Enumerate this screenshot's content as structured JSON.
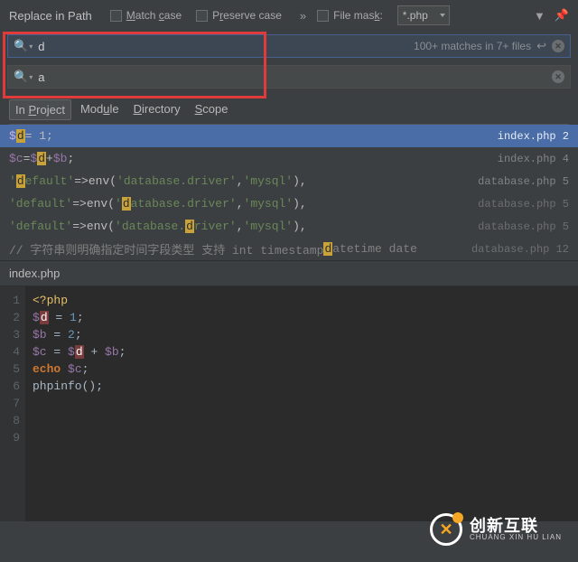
{
  "header": {
    "title": "Replace in Path",
    "match_case": "Match case",
    "preserve_case": "Preserve case",
    "file_mask_label": "File mask:",
    "file_mask_value": "*.php"
  },
  "search": {
    "find_value": "d",
    "replace_value": "a",
    "match_info": "100+ matches in 7+ files"
  },
  "scope_tabs": {
    "project": "In Project",
    "module": "Module",
    "directory": "Directory",
    "scope": "Scope"
  },
  "results": [
    {
      "tokens": [
        {
          "t": "$",
          "c": "m-var"
        },
        {
          "t": "d",
          "c": "hl-box"
        },
        {
          "t": " = 1;",
          "c": "m-op"
        }
      ],
      "file": "index.php",
      "line": "2",
      "sel": true
    },
    {
      "tokens": [
        {
          "t": "$c",
          "c": "m-var"
        },
        {
          "t": " = ",
          "c": "m-op"
        },
        {
          "t": "$",
          "c": "m-var"
        },
        {
          "t": "d",
          "c": "hl-box"
        },
        {
          "t": " + ",
          "c": "m-op"
        },
        {
          "t": "$b",
          "c": "m-var"
        },
        {
          "t": ";",
          "c": "m-op"
        }
      ],
      "file": "index.php",
      "line": "4"
    },
    {
      "tokens": [
        {
          "t": "'",
          "c": "m-str"
        },
        {
          "t": "d",
          "c": "hl-box"
        },
        {
          "t": "efault'",
          "c": "m-str"
        },
        {
          "t": "      => ",
          "c": "m-op"
        },
        {
          "t": "env(",
          "c": ""
        },
        {
          "t": "'database.driver'",
          "c": "m-str"
        },
        {
          "t": ", ",
          "c": "m-op"
        },
        {
          "t": "'mysql'",
          "c": "m-str"
        },
        {
          "t": "),",
          "c": "m-op"
        }
      ],
      "file": "database.php",
      "line": "5"
    },
    {
      "tokens": [
        {
          "t": "'default'",
          "c": "m-str"
        },
        {
          "t": "      => ",
          "c": "m-op"
        },
        {
          "t": "env(",
          "c": ""
        },
        {
          "t": "'",
          "c": "m-str"
        },
        {
          "t": "d",
          "c": "hl-box"
        },
        {
          "t": "atabase.driver'",
          "c": "m-str"
        },
        {
          "t": ", ",
          "c": "m-op"
        },
        {
          "t": "'mysql'",
          "c": "m-str"
        },
        {
          "t": "),",
          "c": "m-op"
        }
      ],
      "file": "database.php",
      "line": "5",
      "dim": true
    },
    {
      "tokens": [
        {
          "t": "'default'",
          "c": "m-str"
        },
        {
          "t": "      => ",
          "c": "m-op"
        },
        {
          "t": "env(",
          "c": ""
        },
        {
          "t": "'database.",
          "c": "m-str"
        },
        {
          "t": "d",
          "c": "hl-box"
        },
        {
          "t": "river'",
          "c": "m-str"
        },
        {
          "t": ", ",
          "c": "m-op"
        },
        {
          "t": "'mysql'",
          "c": "m-str"
        },
        {
          "t": "),",
          "c": "m-op"
        }
      ],
      "file": "database.php",
      "line": "5",
      "dim": true
    },
    {
      "tokens": [
        {
          "t": "// 字符串则明确指定时间字段类型 支持 int timestamp ",
          "c": "m-cmt"
        },
        {
          "t": "d",
          "c": "hl-box"
        },
        {
          "t": "atetime date",
          "c": "m-cmt"
        }
      ],
      "file": "database.php",
      "line": "12",
      "dim": true
    }
  ],
  "editor": {
    "filename": "index.php",
    "lines": [
      [
        {
          "t": "<?php",
          "c": "ed-tag"
        }
      ],
      [
        {
          "t": "$",
          "c": "ed-var"
        },
        {
          "t": "d",
          "c": "ed-hl"
        },
        {
          "t": " = ",
          "c": "ed-op"
        },
        {
          "t": "1",
          "c": "ed-num"
        },
        {
          "t": ";",
          "c": "ed-op"
        }
      ],
      [
        {
          "t": "$b",
          "c": "ed-var"
        },
        {
          "t": " = ",
          "c": "ed-op"
        },
        {
          "t": "2",
          "c": "ed-num"
        },
        {
          "t": ";",
          "c": "ed-op"
        }
      ],
      [
        {
          "t": "$c",
          "c": "ed-var"
        },
        {
          "t": " = ",
          "c": "ed-op"
        },
        {
          "t": "$",
          "c": "ed-var"
        },
        {
          "t": "d",
          "c": "ed-hl"
        },
        {
          "t": " + ",
          "c": "ed-op"
        },
        {
          "t": "$b",
          "c": "ed-var"
        },
        {
          "t": ";",
          "c": "ed-op"
        }
      ],
      [
        {
          "t": "echo",
          "c": "ed-kw"
        },
        {
          "t": " ",
          "c": ""
        },
        {
          "t": "$c",
          "c": "ed-var"
        },
        {
          "t": ";",
          "c": "ed-op"
        }
      ],
      [
        {
          "t": "phpinfo",
          "c": ""
        },
        {
          "t": "();",
          "c": "ed-op"
        }
      ],
      [],
      [],
      []
    ]
  },
  "logo": {
    "big": "创新互联",
    "small": "CHUANG XIN HU LIAN"
  }
}
